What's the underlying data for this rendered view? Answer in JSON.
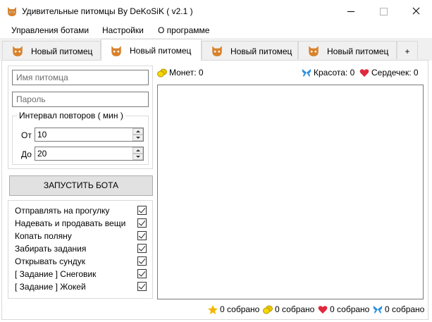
{
  "window": {
    "title": "Удивительные питомцы By DeKoSiK ( v2.1 )",
    "app_icon": "cat-icon"
  },
  "menu": [
    "Управления ботами",
    "Настройки",
    "О программе"
  ],
  "tabs": [
    {
      "label": "Новый питомец",
      "active": false
    },
    {
      "label": "Новый питомец",
      "active": true
    },
    {
      "label": "Новый питомец",
      "active": false
    },
    {
      "label": "Новый питомец",
      "active": false
    }
  ],
  "add_tab_label": "+",
  "form": {
    "pet_name_placeholder": "Имя питомца",
    "password_placeholder": "Пароль",
    "interval_title": "Интервал повторов ( мин )",
    "from_label": "От",
    "from_value": "10",
    "to_label": "До",
    "to_value": "20"
  },
  "start_button": "ЗАПУСТИТЬ БОТА",
  "options": [
    {
      "label": "Отправлять на прогулку",
      "checked": true
    },
    {
      "label": "Надевать и продавать вещи",
      "checked": true
    },
    {
      "label": "Копать поляну",
      "checked": true
    },
    {
      "label": "Забирать задания",
      "checked": true
    },
    {
      "label": "Открывать сундук",
      "checked": true
    },
    {
      "label": "[ Задание ] Снеговик",
      "checked": true
    },
    {
      "label": "[ Задание ] Жокей",
      "checked": true
    }
  ],
  "stats": {
    "coins": "Монет: 0",
    "beauty": "Красота: 0",
    "hearts": "Сердечек: 0"
  },
  "collected": {
    "stars": "0 собрано",
    "coins": "0 собрано",
    "hearts": "0 собрано",
    "butterflies": "0 собрано"
  },
  "colors": {
    "coin": "#e8c800",
    "heart": "#e0283c",
    "butterfly": "#2a8fe0",
    "star": "#f2b705"
  }
}
